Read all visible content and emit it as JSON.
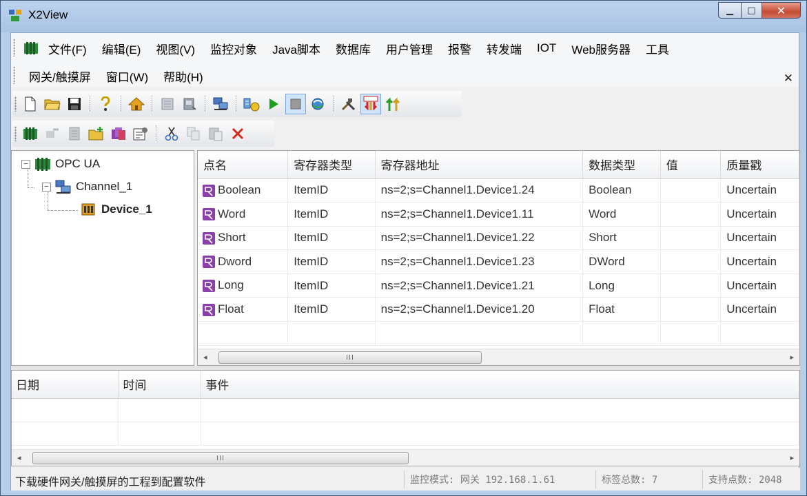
{
  "window": {
    "title": "X2View"
  },
  "menu": {
    "row1": [
      "文件(F)",
      "编辑(E)",
      "视图(V)",
      "监控对象",
      "Java脚本",
      "数据库",
      "用户管理",
      "报警",
      "转发端",
      "IOT",
      "Web服务器",
      "工具"
    ],
    "row2": [
      "网关/触摸屏",
      "窗口(W)",
      "帮助(H)"
    ]
  },
  "tree": {
    "root": "OPC UA",
    "channel": "Channel_1",
    "device": "Device_1"
  },
  "grid": {
    "columns": [
      "点名",
      "寄存器类型",
      "寄存器地址",
      "数据类型",
      "值",
      "质量戳"
    ],
    "rows": [
      {
        "name": "Boolean",
        "reg_type": "ItemID",
        "address": "ns=2;s=Channel1.Device1.24",
        "data_type": "Boolean",
        "value": "",
        "quality": "Uncertain"
      },
      {
        "name": "Word",
        "reg_type": "ItemID",
        "address": "ns=2;s=Channel1.Device1.11",
        "data_type": "Word",
        "value": "",
        "quality": "Uncertain"
      },
      {
        "name": "Short",
        "reg_type": "ItemID",
        "address": "ns=2;s=Channel1.Device1.22",
        "data_type": "Short",
        "value": "",
        "quality": "Uncertain"
      },
      {
        "name": "Dword",
        "reg_type": "ItemID",
        "address": "ns=2;s=Channel1.Device1.23",
        "data_type": "DWord",
        "value": "",
        "quality": "Uncertain"
      },
      {
        "name": "Long",
        "reg_type": "ItemID",
        "address": "ns=2;s=Channel1.Device1.21",
        "data_type": "Long",
        "value": "",
        "quality": "Uncertain"
      },
      {
        "name": "Float",
        "reg_type": "ItemID",
        "address": "ns=2;s=Channel1.Device1.20",
        "data_type": "Float",
        "value": "",
        "quality": "Uncertain"
      }
    ]
  },
  "log": {
    "columns": [
      "日期",
      "时间",
      "事件"
    ]
  },
  "scroll_thumb": "III",
  "status": {
    "message": "下载硬件网关/触摸屏的工程到配置软件",
    "monitor": "监控模式: 网关 192.168.1.61",
    "tag_total": "标签总数: 7",
    "supported": "支持点数: 2048"
  },
  "colors": {
    "tag_icon": "#8b3fa8",
    "run_green": "#1ea01e",
    "close_red": "#c94a32"
  }
}
